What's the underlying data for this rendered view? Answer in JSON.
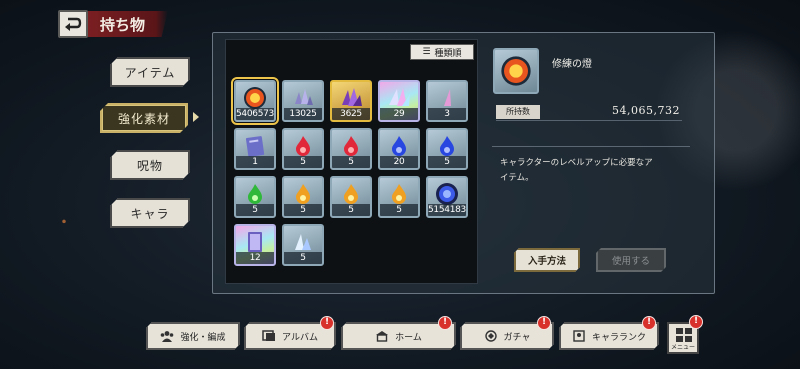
{
  "header": {
    "title": "持ち物"
  },
  "tabs": [
    {
      "label": "アイテム",
      "active": false
    },
    {
      "label": "強化素材",
      "active": true
    },
    {
      "label": "呪物",
      "active": false
    },
    {
      "label": "キャラ",
      "active": false
    }
  ],
  "sort": {
    "label": "種類順"
  },
  "items": [
    {
      "count": "54065732",
      "icon": "fire-orb-icon",
      "frame": "silver",
      "selected": true
    },
    {
      "count": "13025",
      "icon": "crystal-shards-icon",
      "frame": "silver"
    },
    {
      "count": "3625",
      "icon": "purple-crystal-icon",
      "frame": "gold"
    },
    {
      "count": "29",
      "icon": "rainbow-crystal-icon",
      "frame": "holo"
    },
    {
      "count": "3",
      "icon": "pink-shard-icon",
      "frame": "silver"
    },
    {
      "count": "1",
      "icon": "blue-book-icon",
      "frame": "silver"
    },
    {
      "count": "5",
      "icon": "red-flame-icon",
      "frame": "silver"
    },
    {
      "count": "5",
      "icon": "red-flame-icon",
      "frame": "silver"
    },
    {
      "count": "20",
      "icon": "blue-flame-icon",
      "frame": "silver"
    },
    {
      "count": "5",
      "icon": "blue-flame-icon",
      "frame": "silver"
    },
    {
      "count": "5",
      "icon": "green-flame-icon",
      "frame": "silver"
    },
    {
      "count": "5",
      "icon": "yellow-flame-icon",
      "frame": "silver"
    },
    {
      "count": "5",
      "icon": "yellow-flame-icon",
      "frame": "silver"
    },
    {
      "count": "5",
      "icon": "yellow-flame-icon",
      "frame": "silver"
    },
    {
      "count": "5154183",
      "icon": "blue-orb-icon",
      "frame": "silver"
    },
    {
      "count": "12",
      "icon": "holo-card-icon",
      "frame": "holo"
    },
    {
      "count": "5",
      "icon": "ice-shard-icon",
      "frame": "silver"
    }
  ],
  "detail": {
    "name": "修練の燈",
    "qty_label": "所持数",
    "qty_value": "54,065,732",
    "description_line1": "キャラクターのレベルアップに必要なア",
    "description_line2": "イテム。",
    "acquire_label": "入手方法",
    "use_label": "使用する"
  },
  "nav": [
    {
      "label": "強化・編成",
      "badge": false
    },
    {
      "label": "アルバム",
      "badge": true
    },
    {
      "label": "ホーム",
      "badge": true
    },
    {
      "label": "ガチャ",
      "badge": true
    },
    {
      "label": "キャラランク",
      "badge": true
    }
  ],
  "menu": {
    "label": "メニュー",
    "badge": "!"
  },
  "badge_text": "!"
}
